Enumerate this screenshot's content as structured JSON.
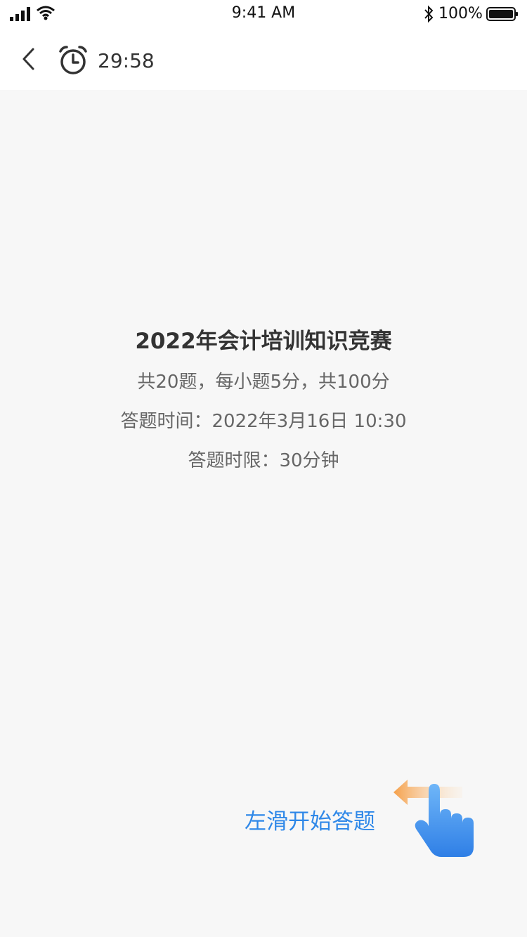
{
  "status_bar": {
    "time": "9:41 AM",
    "battery": "100%",
    "icons": [
      "signal-icon",
      "wifi-icon",
      "bluetooth-icon",
      "battery-icon"
    ]
  },
  "nav": {
    "back_icon": "chevron-left-icon",
    "timer_icon": "alarm-clock-icon",
    "countdown": "29:58"
  },
  "quiz": {
    "title": "2022年会计培训知识竞赛",
    "summary": "共20题，每小题5分，共100分",
    "time": "答题时间：2022年3月16日  10:30",
    "limit": "答题时限：30分钟"
  },
  "swipe": {
    "label": "左滑开始答题",
    "icon": "swipe-left-hand-icon"
  },
  "colors": {
    "accent": "#2f88e8",
    "arrow": "#f5a04a",
    "background": "#f7f7f7",
    "header": "#ffffff"
  }
}
